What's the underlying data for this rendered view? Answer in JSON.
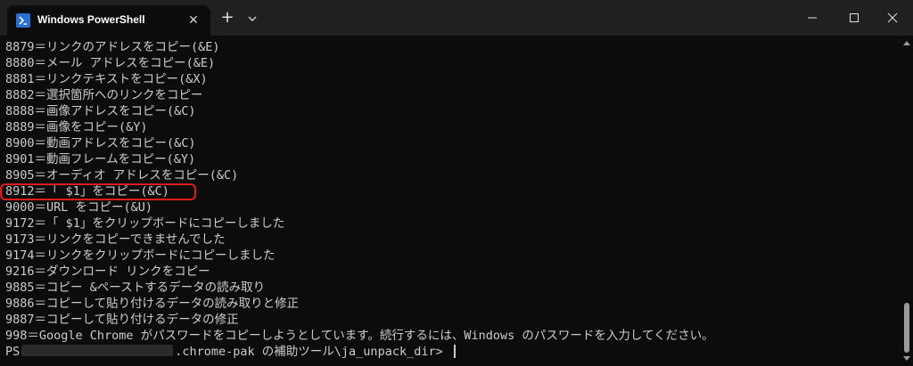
{
  "window": {
    "tab_title": "Windows PowerShell",
    "tab_icon": "powershell-icon",
    "new_tab_label": "+",
    "close_tab_label": "✕"
  },
  "terminal": {
    "lines": [
      "8879＝リンクのアドレスをコピー(&E)",
      "8880＝メール アドレスをコピー(&E)",
      "8881＝リンクテキストをコピー(&X)",
      "8882＝選択箇所へのリンクをコピー",
      "8888＝画像アドレスをコピー(&C)",
      "8889＝画像をコピー(&Y)",
      "8900＝動画アドレスをコピー(&C)",
      "8901＝動画フレームをコピー(&Y)",
      "8905＝オーディオ アドレスをコピー(&C)",
      "8912＝「 $1」をコピー(&C)",
      "9000＝URL をコピー(&U)",
      "9172＝「 $1」をクリップボードにコピーしました",
      "9173＝リンクをコピーできませんでした",
      "9174＝リンクをクリップボードにコピーしました",
      "9216＝ダウンロード リンクをコピー",
      "9885＝コピー &ペーストするデータの読み取り",
      "9886＝コピーして貼り付けるデータの読み取りと修正",
      "9887＝コピーして貼り付けるデータの修正",
      "998＝Google Chrome がパスワードをコピーしようとしています。続行するには、Windows のパスワードを入力してください。"
    ],
    "prompt_prefix": "PS",
    "prompt_suffix": ".chrome-pak の補助ツール\\ja_unpack_dir> ",
    "highlighted_line_index": 9
  },
  "colors": {
    "background": "#0c0c0c",
    "titlebar": "#202020",
    "text": "#cccccc",
    "highlight": "#e01b1b"
  }
}
